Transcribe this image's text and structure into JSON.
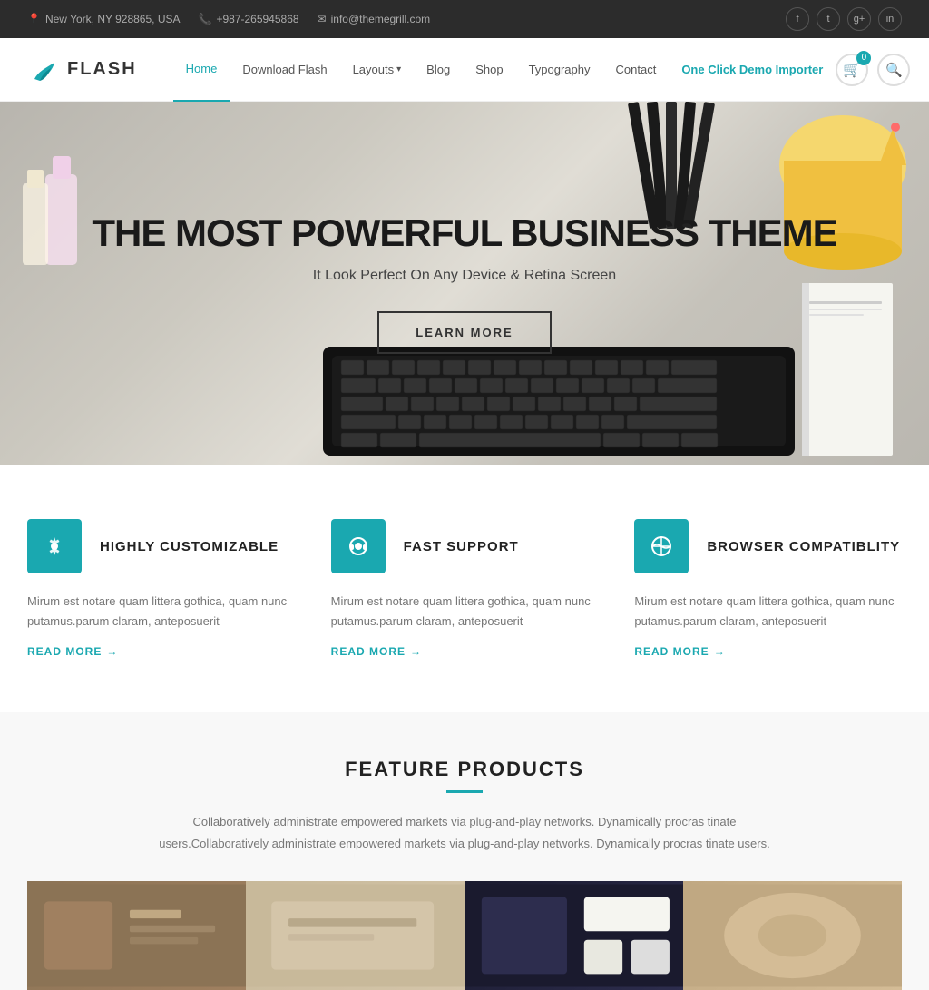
{
  "topbar": {
    "location": "New York, NY 928865, USA",
    "phone": "+987-265945868",
    "email": "info@themegrill.com",
    "social": [
      "f",
      "t",
      "g+",
      "in"
    ]
  },
  "navbar": {
    "logo_text": "FLASH",
    "nav_items": [
      {
        "label": "Home",
        "active": true,
        "has_dropdown": false
      },
      {
        "label": "Download Flash",
        "active": false,
        "has_dropdown": false
      },
      {
        "label": "Layouts",
        "active": false,
        "has_dropdown": true
      },
      {
        "label": "Blog",
        "active": false,
        "has_dropdown": false
      },
      {
        "label": "Shop",
        "active": false,
        "has_dropdown": false
      },
      {
        "label": "Typography",
        "active": false,
        "has_dropdown": false
      },
      {
        "label": "Contact",
        "active": false,
        "has_dropdown": false
      },
      {
        "label": "One Click Demo Importer",
        "active": false,
        "has_dropdown": false,
        "special": true
      }
    ],
    "cart_count": "0"
  },
  "hero": {
    "title": "THE MOST POWERFUL BUSINESS THEME",
    "subtitle": "It Look Perfect On Any Device & Retina Screen",
    "cta_label": "LEARN MORE"
  },
  "features": [
    {
      "icon": "⚙",
      "title": "HIGHLY CUSTOMIZABLE",
      "text": "Mirum est notare quam littera gothica, quam nunc putamus.parum claram, anteposuerit",
      "read_more": "READ MORE"
    },
    {
      "icon": "◎",
      "title": "FAST SUPPORT",
      "text": "Mirum est notare quam littera gothica, quam nunc putamus.parum claram, anteposuerit",
      "read_more": "READ MORE"
    },
    {
      "icon": "◑",
      "title": "BROWSER COMPATIBLITY",
      "text": "Mirum est notare quam littera gothica, quam nunc putamus.parum claram, anteposuerit",
      "read_more": "READ MORE"
    }
  ],
  "products_section": {
    "title": "FEATURE PRODUCTS",
    "description": "Collaboratively administrate empowered markets via plug-and-play networks. Dynamically procras tinate users.Collaboratively administrate empowered markets via plug-and-play networks. Dynamically procras tinate users."
  }
}
